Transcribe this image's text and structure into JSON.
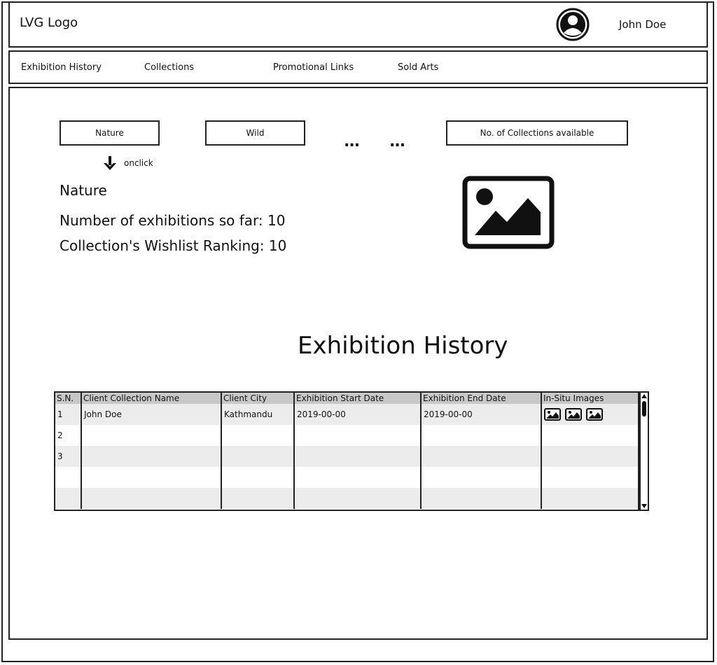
{
  "header": {
    "logo": "LVG Logo",
    "user_name": "John Doe"
  },
  "nav": {
    "items": [
      "Exhibition History",
      "Collections",
      "Promotional Links",
      "Sold Arts"
    ]
  },
  "collections": {
    "tabs": [
      "Nature",
      "Wild"
    ],
    "ellipsis": "...",
    "count_button": "No. of Collections available",
    "onclick_label": "onclick"
  },
  "detail": {
    "title": "Nature",
    "exhibitions": "Number of exhibitions so far: 10",
    "ranking": "Collection's Wishlist Ranking: 10"
  },
  "history": {
    "title": "Exhibition History",
    "columns": [
      "S.N.",
      "Client Collection Name",
      "Client City",
      "Exhibition Start Date",
      "Exhibition End Date",
      "In-Situ Images"
    ],
    "rows": [
      [
        "1",
        "John Doe",
        "Kathmandu",
        "2019-00-00",
        "2019-00-00",
        ""
      ],
      [
        "2",
        "",
        "",
        "",
        "",
        ""
      ],
      [
        "3",
        "",
        "",
        "",
        "",
        ""
      ],
      [
        "",
        "",
        "",
        "",
        "",
        ""
      ],
      [
        "",
        "",
        "",
        "",
        "",
        ""
      ]
    ]
  },
  "icons": {
    "avatar": "user-avatar-icon",
    "arrow": "arrow-down-icon",
    "image": "image-placeholder-icon"
  }
}
